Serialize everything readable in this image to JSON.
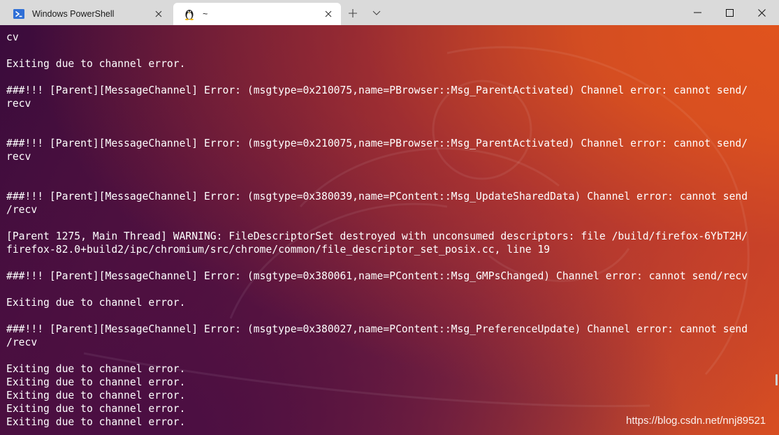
{
  "tabs": [
    {
      "label": "Windows PowerShell",
      "icon": "powershell-icon",
      "active": false
    },
    {
      "label": "~",
      "icon": "linux-penguin-icon",
      "active": true
    }
  ],
  "tab_bar": {
    "new_tab_icon": "plus-icon",
    "dropdown_icon": "chevron-down-icon"
  },
  "window_controls": {
    "minimize_icon": "minimize-icon",
    "maximize_icon": "maximize-icon",
    "close_icon": "close-icon"
  },
  "terminal": {
    "lines": [
      "cv",
      "",
      "Exiting due to channel error.",
      "",
      "###!!! [Parent][MessageChannel] Error: (msgtype=0x210075,name=PBrowser::Msg_ParentActivated) Channel error: cannot send/",
      "recv",
      "",
      "",
      "###!!! [Parent][MessageChannel] Error: (msgtype=0x210075,name=PBrowser::Msg_ParentActivated) Channel error: cannot send/",
      "recv",
      "",
      "",
      "###!!! [Parent][MessageChannel] Error: (msgtype=0x380039,name=PContent::Msg_UpdateSharedData) Channel error: cannot send",
      "/recv",
      "",
      "[Parent 1275, Main Thread] WARNING: FileDescriptorSet destroyed with unconsumed descriptors: file /build/firefox-6YbT2H/",
      "firefox-82.0+build2/ipc/chromium/src/chrome/common/file_descriptor_set_posix.cc, line 19",
      "",
      "###!!! [Parent][MessageChannel] Error: (msgtype=0x380061,name=PContent::Msg_GMPsChanged) Channel error: cannot send/recv",
      "",
      "Exiting due to channel error.",
      "",
      "###!!! [Parent][MessageChannel] Error: (msgtype=0x380027,name=PContent::Msg_PreferenceUpdate) Channel error: cannot send",
      "/recv",
      "",
      "Exiting due to channel error.",
      "Exiting due to channel error.",
      "Exiting due to channel error.",
      "Exiting due to channel error.",
      "Exiting due to channel error."
    ]
  },
  "watermark": "https://blog.csdn.net/nnj89521",
  "colors": {
    "titlebar": "#dadada",
    "active_tab": "#ffffff",
    "terminal_text": "#ffffff",
    "terminal_bg_dark": "#3a0b3c",
    "terminal_bg_orange": "#e0531d",
    "powershell_blue": "#2f6fd6"
  }
}
